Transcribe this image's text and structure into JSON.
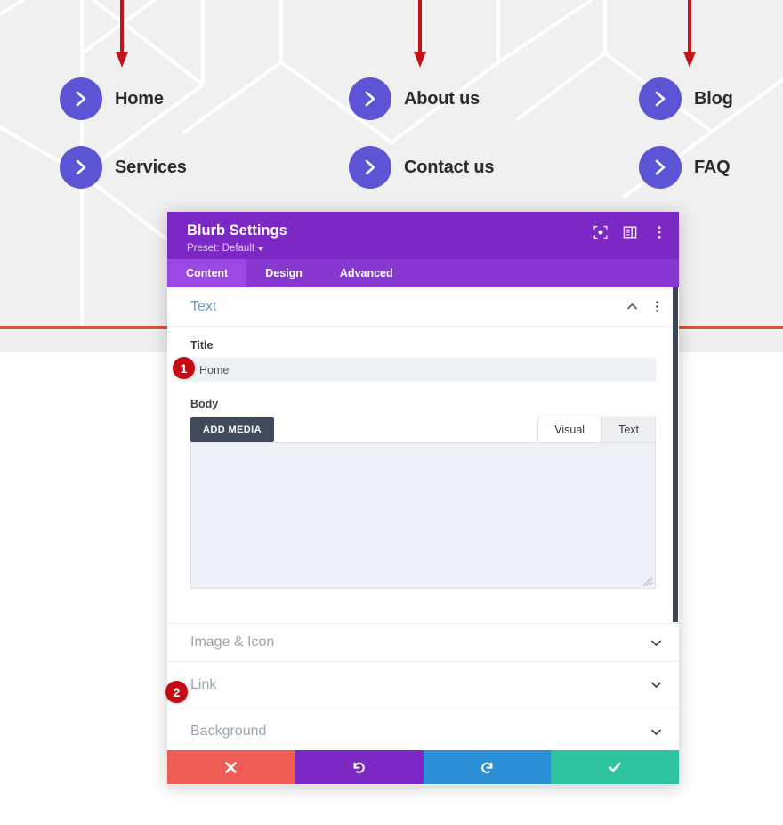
{
  "page": {
    "nav_items": [
      {
        "label": "Home",
        "icon": "chevron-right-icon"
      },
      {
        "label": "About us",
        "icon": "chevron-right-icon"
      },
      {
        "label": "Blog",
        "icon": "chevron-right-icon"
      },
      {
        "label": "Services",
        "icon": "chevron-right-icon"
      },
      {
        "label": "Contact us",
        "icon": "chevron-right-icon"
      },
      {
        "label": "FAQ",
        "icon": "chevron-right-icon"
      }
    ],
    "annotation_arrows": 3,
    "colors": {
      "blurb_circle": "#5b55d6",
      "hero_bg": "#f0f0f0",
      "divider_rule": "#d9503f",
      "badge": "#c40a14"
    }
  },
  "modal": {
    "title": "Blurb Settings",
    "preset_label": "Preset: Default",
    "header_icons": [
      {
        "name": "focus-icon"
      },
      {
        "name": "layout-panel-icon"
      },
      {
        "name": "more-vertical-icon"
      }
    ],
    "tabs": [
      {
        "label": "Content",
        "active": true
      },
      {
        "label": "Design",
        "active": false
      },
      {
        "label": "Advanced",
        "active": false
      }
    ],
    "sections": [
      {
        "label": "Text",
        "expanded": true,
        "chevron": "chevron-up-icon",
        "badge": null
      },
      {
        "label": "Image & Icon",
        "expanded": false,
        "chevron": "chevron-down-icon",
        "badge": null
      },
      {
        "label": "Link",
        "expanded": false,
        "chevron": "chevron-down-icon",
        "badge": "2"
      },
      {
        "label": "Background",
        "expanded": false,
        "chevron": "chevron-down-icon",
        "badge": null
      }
    ],
    "text_section": {
      "title_field": {
        "label": "Title",
        "value": "Home",
        "placeholder": "",
        "badge": "1"
      },
      "body_field": {
        "label": "Body",
        "add_media_label": "ADD MEDIA",
        "editor_tabs": [
          {
            "label": "Visual",
            "active": false
          },
          {
            "label": "Text",
            "active": true
          }
        ],
        "value": "",
        "placeholder": ""
      }
    },
    "footer_buttons": [
      {
        "name": "cancel-button",
        "icon": "close-icon",
        "color": "#ee5c55"
      },
      {
        "name": "undo-button",
        "icon": "undo-icon",
        "color": "#7b28c4"
      },
      {
        "name": "redo-button",
        "icon": "redo-icon",
        "color": "#2a8fd4"
      },
      {
        "name": "save-button",
        "icon": "check-icon",
        "color": "#2ec4a0"
      }
    ],
    "colors": {
      "header": "#7b28c4",
      "tabbar": "#8738d1",
      "tab_active": "#9a47e3",
      "section_title": "#6c9ab5",
      "scrollbar": "#3a4553"
    }
  }
}
